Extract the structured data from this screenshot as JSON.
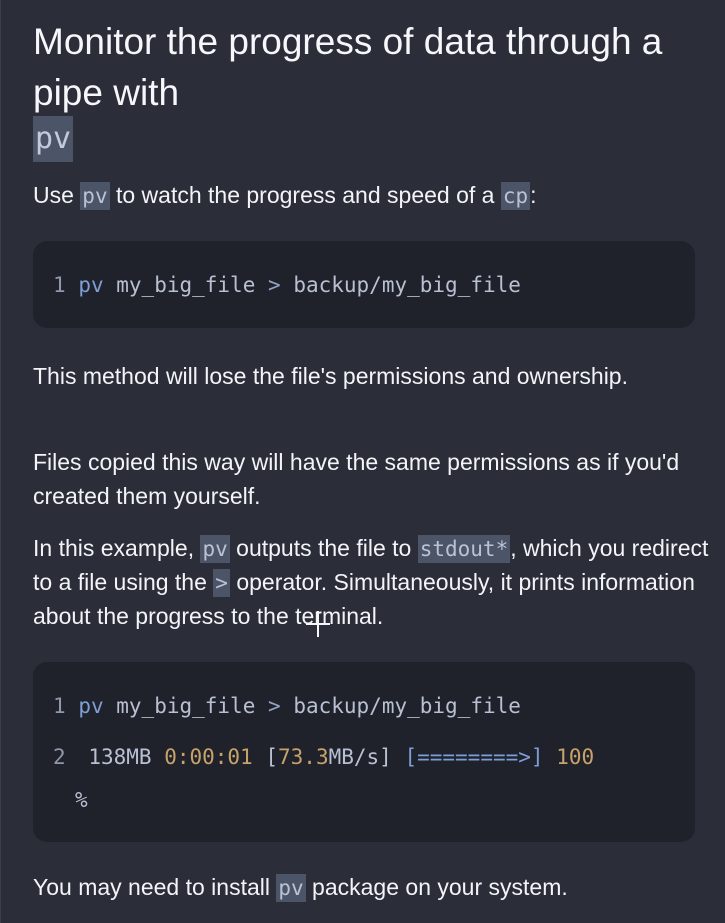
{
  "heading": {
    "line1": "Monitor the progress of data through a",
    "line2": "pipe with",
    "code": "pv"
  },
  "intro": {
    "before": "Use ",
    "code1": "pv",
    "middle": " to watch the progress and speed of a ",
    "code2": "cp",
    "after": ":"
  },
  "block1": {
    "lines": [
      {
        "number": "1",
        "command": "pv",
        "arg1": "my_big_file",
        "operator": ">",
        "arg2": "backup/my_big_file"
      }
    ]
  },
  "para2": "This method will lose the file's permissions and ownership.",
  "para3": "Files copied this way will have the same permissions as if you'd created them yourself.",
  "para4": {
    "part1": "In this example, ",
    "code1": "pv",
    "part2": " outputs the file to ",
    "code2": "stdout*",
    "part3": ", which you redirect to a file using the ",
    "code3": ">",
    "part4": " operator. Simultaneously, it prints information about the progress to the terminal."
  },
  "block2": {
    "line1": {
      "number": "1",
      "command": "pv",
      "arg1": "my_big_file",
      "operator": ">",
      "arg2": "backup/my_big_file"
    },
    "line2": {
      "number": "2",
      "size": "138MB",
      "time": "0:00:01",
      "rate_open": "[",
      "rate_value": "73.3",
      "rate_close": "MB/s]",
      "bar": "[========>]",
      "percent": "100",
      "percent_sign": "%"
    }
  },
  "footer": {
    "before": "You may need to install ",
    "code": "pv",
    "after": " package on your system."
  }
}
